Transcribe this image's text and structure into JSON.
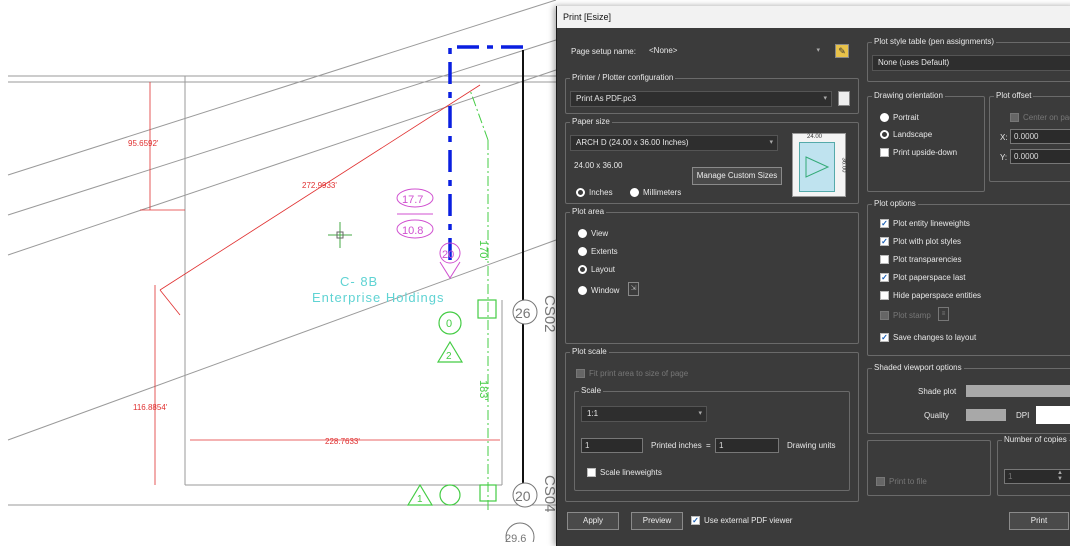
{
  "drawing": {
    "dims": {
      "d1": "95.6592'",
      "d2": "272.9933'",
      "d3": "116.8854'",
      "d4": "228.7633'",
      "d5": "170'",
      "d6": "183'"
    },
    "labels": {
      "tenant_line1": "C-  8B",
      "tenant_line2": "Enterprise Holdings",
      "tag1_top": "17.7",
      "tag1_bottom": "10.8",
      "tag2": "20",
      "bubble_26": "26",
      "bubble_20": "20",
      "bubble_296": "29.6",
      "cs02": "CS02",
      "cs04": "CS04",
      "zero": "0",
      "two": "2",
      "one": "1"
    }
  },
  "dialog": {
    "title": "Print [Esize]",
    "page_setup": {
      "label": "Page setup name:",
      "value": "<None>"
    },
    "printer": {
      "group": "Printer / Plotter configuration",
      "value": "Print As PDF.pc3"
    },
    "paper": {
      "group": "Paper size",
      "value": "ARCH D (24.00 x 36.00 Inches)",
      "dims": "24.00 x 36.00",
      "manage_button": "Manage Custom Sizes",
      "units_inches": "Inches",
      "units_mm": "Millimeters",
      "preview_top": "24.00",
      "preview_side": "36.00"
    },
    "plot_area": {
      "group": "Plot area",
      "options": [
        "View",
        "Extents",
        "Layout",
        "Window"
      ],
      "selected": "Layout"
    },
    "plot_scale": {
      "group": "Plot scale",
      "fit_label": "Fit print area to size of page",
      "scale_group": "Scale",
      "scale_value": "1:1",
      "printed_value": "1",
      "printed_label": "Printed inches",
      "equals": "=",
      "units_value": "1",
      "units_label": "Drawing units",
      "lineweights_label": "Scale lineweights"
    },
    "plot_style": {
      "group": "Plot style table (pen assignments)",
      "value": "None (uses Default)"
    },
    "orientation": {
      "group": "Drawing orientation",
      "portrait": "Portrait",
      "landscape": "Landscape",
      "upside_down": "Print upside-down",
      "selected": "Portrait"
    },
    "offset": {
      "group": "Plot offset",
      "center": "Center on page",
      "x_label": "X:",
      "x_value": "0.0000",
      "y_label": "Y:",
      "y_value": "0.0000"
    },
    "plot_options": {
      "group": "Plot options",
      "items": [
        {
          "label": "Plot entity lineweights",
          "checked": true
        },
        {
          "label": "Plot with plot styles",
          "checked": true
        },
        {
          "label": "Plot transparencies",
          "checked": false
        },
        {
          "label": "Plot paperspace last",
          "checked": true
        },
        {
          "label": "Hide paperspace entities",
          "checked": false
        },
        {
          "label": "Plot stamp",
          "checked": false
        },
        {
          "label": "Save changes to layout",
          "checked": true
        }
      ]
    },
    "shaded": {
      "group": "Shaded viewport options",
      "shade_label": "Shade plot",
      "quality_label": "Quality",
      "dpi_label": "DPI"
    },
    "print_to_file": "Print to file",
    "copies": {
      "group": "Number of copies",
      "value": "1"
    },
    "buttons": {
      "apply": "Apply",
      "preview": "Preview",
      "external_viewer": "Use external PDF viewer",
      "print": "Print"
    },
    "colors": {
      "accent_blue": "#1a5fb4",
      "bg": "#3b3b3b"
    }
  }
}
